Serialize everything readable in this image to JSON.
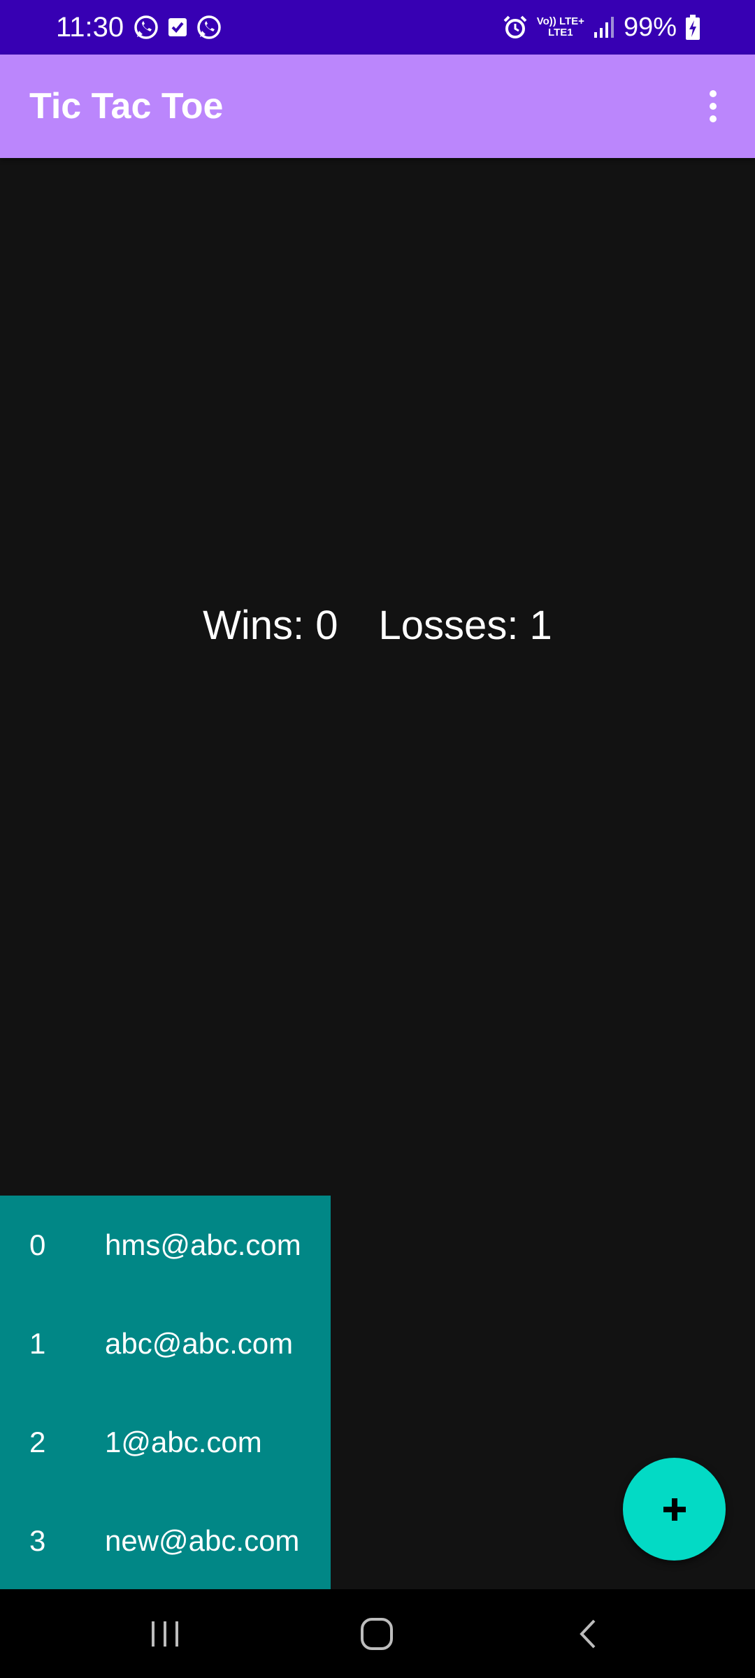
{
  "status_bar": {
    "time": "11:30",
    "left_icons": [
      "whatsapp-icon",
      "check-square-icon",
      "whatsapp-icon"
    ],
    "network_line1": "Vo)) LTE+",
    "network_line2": "LTE1",
    "battery": "99%",
    "background_color": "#3700b3"
  },
  "app_bar": {
    "title": "Tic Tac Toe",
    "menu_icon": "more-vert-icon",
    "background_color": "#bb86fc"
  },
  "score": {
    "wins_label": "Wins: 0",
    "losses_label": "Losses: 1"
  },
  "players": [
    {
      "index": "0",
      "email": "hms@abc.com"
    },
    {
      "index": "1",
      "email": "abc@abc.com"
    },
    {
      "index": "2",
      "email": "1@abc.com"
    },
    {
      "index": "3",
      "email": "new@abc.com"
    }
  ],
  "fab": {
    "icon": "plus-icon",
    "color": "#03dac5"
  },
  "nav_bar": {
    "recents_icon": "recents-icon",
    "home_icon": "home-icon",
    "back_icon": "back-icon"
  },
  "colors": {
    "background": "#121212",
    "list_item": "#018786"
  }
}
